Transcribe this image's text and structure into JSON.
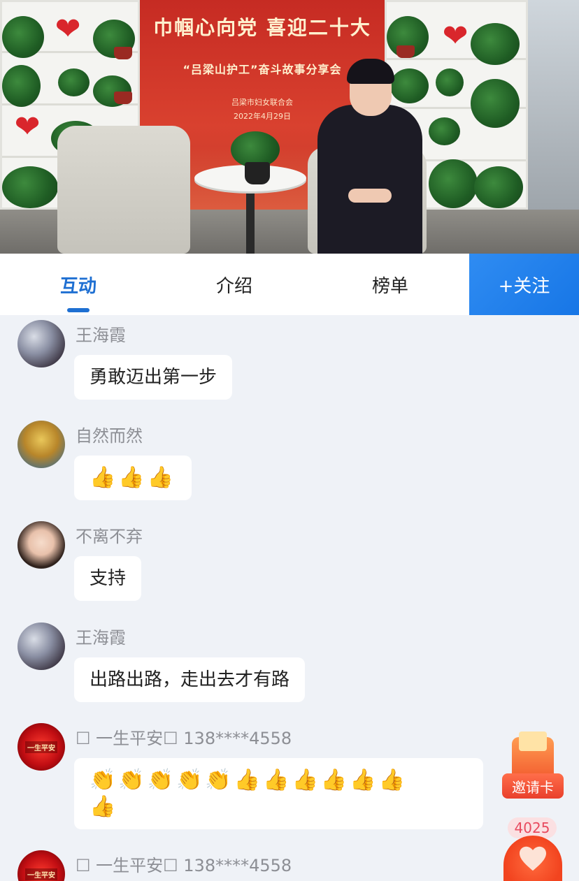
{
  "video": {
    "banner_slogan": "巾帼心向党 喜迎二十大",
    "banner_event": "“吕梁山护工”奋斗故事分享会",
    "banner_org": "吕梁市妇女联合会",
    "banner_date": "2022年4月29日"
  },
  "tabs": [
    {
      "label": "互动",
      "active": true
    },
    {
      "label": "介绍",
      "active": false
    },
    {
      "label": "榜单",
      "active": false
    }
  ],
  "follow_label": "+关注",
  "messages": [
    {
      "user": "王海霞",
      "text": "勇敢迈出第一步",
      "avatar": "warrior-avatar"
    },
    {
      "user": "自然而然",
      "text": "👍👍👍",
      "avatar": "forest-avatar"
    },
    {
      "user": "不离不弃",
      "text": "支持",
      "avatar": "girl-avatar"
    },
    {
      "user": "王海霞",
      "text": "出路出路，走出去才有路",
      "avatar": "warrior-avatar"
    },
    {
      "user": "☐ 一生平安☐ 138****4558",
      "text_line1": "👏👏👏👏👏👍👍👍👍👍👍",
      "text_line2": "👍",
      "avatar": "red-avatar",
      "avatar_text": "一生平安"
    },
    {
      "user": "☐ 一生平安☐ 138****4558",
      "avatar": "red-avatar",
      "avatar_text": "一生平安"
    }
  ],
  "invite_label": "邀请卡",
  "like_count": "4025",
  "colors": {
    "accent": "#1e6fd2",
    "follow_bg": "#1776e6",
    "feed_bg": "#eff2f7",
    "like": "#f2441f"
  }
}
